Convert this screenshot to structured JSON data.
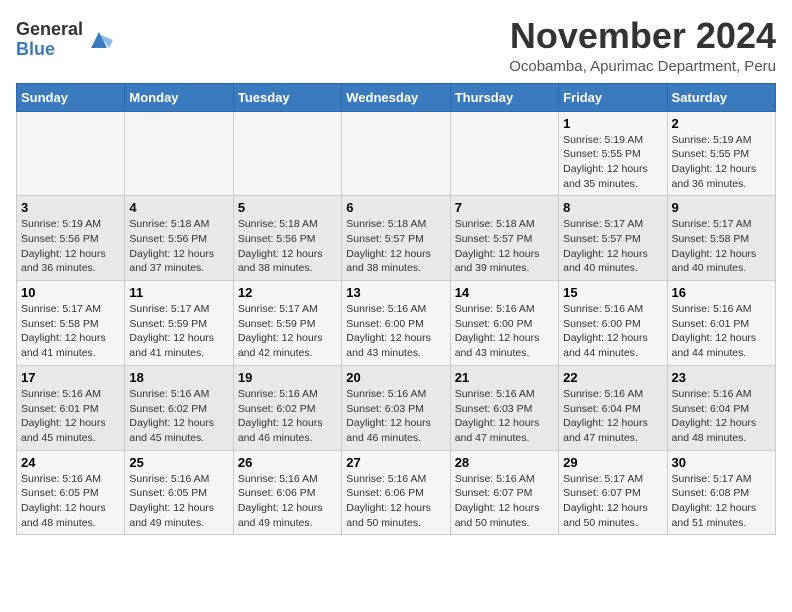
{
  "logo": {
    "general": "General",
    "blue": "Blue"
  },
  "title": {
    "month_year": "November 2024",
    "location": "Ocobamba, Apurimac Department, Peru"
  },
  "weekdays": [
    "Sunday",
    "Monday",
    "Tuesday",
    "Wednesday",
    "Thursday",
    "Friday",
    "Saturday"
  ],
  "weeks": [
    [
      {
        "day": "",
        "info": ""
      },
      {
        "day": "",
        "info": ""
      },
      {
        "day": "",
        "info": ""
      },
      {
        "day": "",
        "info": ""
      },
      {
        "day": "",
        "info": ""
      },
      {
        "day": "1",
        "info": "Sunrise: 5:19 AM\nSunset: 5:55 PM\nDaylight: 12 hours and 35 minutes."
      },
      {
        "day": "2",
        "info": "Sunrise: 5:19 AM\nSunset: 5:55 PM\nDaylight: 12 hours and 36 minutes."
      }
    ],
    [
      {
        "day": "3",
        "info": "Sunrise: 5:19 AM\nSunset: 5:56 PM\nDaylight: 12 hours and 36 minutes."
      },
      {
        "day": "4",
        "info": "Sunrise: 5:18 AM\nSunset: 5:56 PM\nDaylight: 12 hours and 37 minutes."
      },
      {
        "day": "5",
        "info": "Sunrise: 5:18 AM\nSunset: 5:56 PM\nDaylight: 12 hours and 38 minutes."
      },
      {
        "day": "6",
        "info": "Sunrise: 5:18 AM\nSunset: 5:57 PM\nDaylight: 12 hours and 38 minutes."
      },
      {
        "day": "7",
        "info": "Sunrise: 5:18 AM\nSunset: 5:57 PM\nDaylight: 12 hours and 39 minutes."
      },
      {
        "day": "8",
        "info": "Sunrise: 5:17 AM\nSunset: 5:57 PM\nDaylight: 12 hours and 40 minutes."
      },
      {
        "day": "9",
        "info": "Sunrise: 5:17 AM\nSunset: 5:58 PM\nDaylight: 12 hours and 40 minutes."
      }
    ],
    [
      {
        "day": "10",
        "info": "Sunrise: 5:17 AM\nSunset: 5:58 PM\nDaylight: 12 hours and 41 minutes."
      },
      {
        "day": "11",
        "info": "Sunrise: 5:17 AM\nSunset: 5:59 PM\nDaylight: 12 hours and 41 minutes."
      },
      {
        "day": "12",
        "info": "Sunrise: 5:17 AM\nSunset: 5:59 PM\nDaylight: 12 hours and 42 minutes."
      },
      {
        "day": "13",
        "info": "Sunrise: 5:16 AM\nSunset: 6:00 PM\nDaylight: 12 hours and 43 minutes."
      },
      {
        "day": "14",
        "info": "Sunrise: 5:16 AM\nSunset: 6:00 PM\nDaylight: 12 hours and 43 minutes."
      },
      {
        "day": "15",
        "info": "Sunrise: 5:16 AM\nSunset: 6:00 PM\nDaylight: 12 hours and 44 minutes."
      },
      {
        "day": "16",
        "info": "Sunrise: 5:16 AM\nSunset: 6:01 PM\nDaylight: 12 hours and 44 minutes."
      }
    ],
    [
      {
        "day": "17",
        "info": "Sunrise: 5:16 AM\nSunset: 6:01 PM\nDaylight: 12 hours and 45 minutes."
      },
      {
        "day": "18",
        "info": "Sunrise: 5:16 AM\nSunset: 6:02 PM\nDaylight: 12 hours and 45 minutes."
      },
      {
        "day": "19",
        "info": "Sunrise: 5:16 AM\nSunset: 6:02 PM\nDaylight: 12 hours and 46 minutes."
      },
      {
        "day": "20",
        "info": "Sunrise: 5:16 AM\nSunset: 6:03 PM\nDaylight: 12 hours and 46 minutes."
      },
      {
        "day": "21",
        "info": "Sunrise: 5:16 AM\nSunset: 6:03 PM\nDaylight: 12 hours and 47 minutes."
      },
      {
        "day": "22",
        "info": "Sunrise: 5:16 AM\nSunset: 6:04 PM\nDaylight: 12 hours and 47 minutes."
      },
      {
        "day": "23",
        "info": "Sunrise: 5:16 AM\nSunset: 6:04 PM\nDaylight: 12 hours and 48 minutes."
      }
    ],
    [
      {
        "day": "24",
        "info": "Sunrise: 5:16 AM\nSunset: 6:05 PM\nDaylight: 12 hours and 48 minutes."
      },
      {
        "day": "25",
        "info": "Sunrise: 5:16 AM\nSunset: 6:05 PM\nDaylight: 12 hours and 49 minutes."
      },
      {
        "day": "26",
        "info": "Sunrise: 5:16 AM\nSunset: 6:06 PM\nDaylight: 12 hours and 49 minutes."
      },
      {
        "day": "27",
        "info": "Sunrise: 5:16 AM\nSunset: 6:06 PM\nDaylight: 12 hours and 50 minutes."
      },
      {
        "day": "28",
        "info": "Sunrise: 5:16 AM\nSunset: 6:07 PM\nDaylight: 12 hours and 50 minutes."
      },
      {
        "day": "29",
        "info": "Sunrise: 5:17 AM\nSunset: 6:07 PM\nDaylight: 12 hours and 50 minutes."
      },
      {
        "day": "30",
        "info": "Sunrise: 5:17 AM\nSunset: 6:08 PM\nDaylight: 12 hours and 51 minutes."
      }
    ]
  ]
}
